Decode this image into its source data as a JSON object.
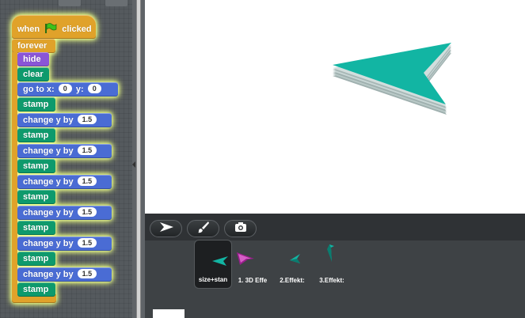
{
  "script": {
    "hat_prefix": "when",
    "hat_suffix": "clicked",
    "forever": "forever",
    "hide": "hide",
    "clear": "clear",
    "goto": {
      "label": "go to x:",
      "y_label": "y:",
      "x": "0",
      "y": "0"
    },
    "stamp": "stamp",
    "change_label": "change y by",
    "change_value": "1.5"
  },
  "costumes": [
    {
      "label": "size+stan",
      "icon": "arrow-teal-icon",
      "selected": true
    },
    {
      "label": "1. 3D Effe",
      "icon": "arrow-purple-icon",
      "selected": false
    },
    {
      "label": "2.Effekt:",
      "icon": "arrow-teal-small-icon",
      "selected": false
    },
    {
      "label": "3.Effekt:",
      "icon": "arrow-teal-vertical-icon",
      "selected": false
    }
  ],
  "tools": [
    {
      "name": "pointer-tool",
      "icon": "pointer-arrow-icon"
    },
    {
      "name": "paint-tool",
      "icon": "paintbrush-icon"
    },
    {
      "name": "camera-tool",
      "icon": "camera-icon"
    }
  ],
  "colors": {
    "control": "#e0a22a",
    "looks": "#8a55d7",
    "pen": "#0e9a6c",
    "motion": "#4a6cd4",
    "sprite_teal": "#12b5a3"
  }
}
